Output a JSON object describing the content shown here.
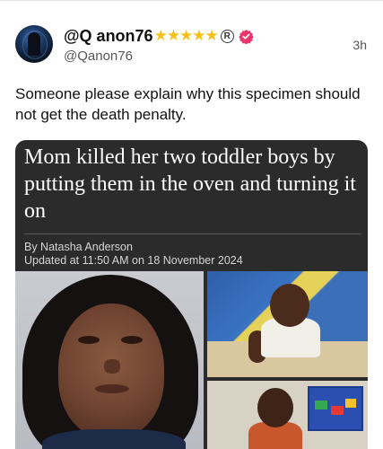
{
  "post": {
    "display_name": "@Q anon76",
    "stars": "★★★★★",
    "registered_mark": "R",
    "handle": "@Qanon76",
    "time": "3h",
    "text": "Someone please explain why this specimen should not get the death penalty."
  },
  "card": {
    "headline": "Mom killed her two toddler boys by putting them in the oven and turning it on",
    "byline": "By Natasha Anderson",
    "updated": "Updated at 11:50 AM on 18 November 2024"
  },
  "colors": {
    "star": "#f5c01a",
    "verified_badge": "#e8356d",
    "card_bg": "#2b2b2b"
  },
  "icons": [
    "avatar",
    "star-icon",
    "registered-icon",
    "verified-badge-icon"
  ]
}
